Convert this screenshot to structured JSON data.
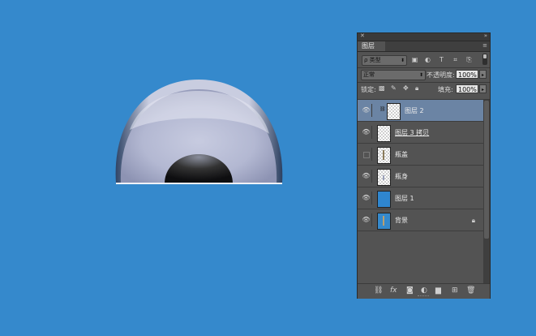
{
  "panel": {
    "tab_label": "图层",
    "close_symbol": "✕",
    "collapse_symbol": "»",
    "menu_symbol": "≡"
  },
  "filter": {
    "kind_label": "ρ 类型",
    "icons": [
      "image-filter-icon",
      "adjustment-filter-icon",
      "type-filter-icon",
      "shape-filter-icon",
      "smart-object-filter-icon"
    ]
  },
  "blend": {
    "mode": "正常",
    "opacity_label": "不透明度:",
    "opacity_value": "100%"
  },
  "lock": {
    "label": "锁定:",
    "fill_label": "填充:",
    "fill_value": "100%"
  },
  "layers": [
    {
      "name": "图层 2",
      "visible": true,
      "selected": true,
      "thumb": "transparent",
      "linked": true
    },
    {
      "name": "图层 3 拷贝",
      "visible": true,
      "selected": false,
      "thumb": "transparent",
      "underline": true
    },
    {
      "name": "瓶盖",
      "visible": false,
      "selected": false,
      "thumb": "transparent"
    },
    {
      "name": "瓶身",
      "visible": true,
      "selected": false,
      "thumb": "transparent"
    },
    {
      "name": "图层 1",
      "visible": true,
      "selected": false,
      "thumb": "blue"
    },
    {
      "name": "背景",
      "visible": true,
      "selected": false,
      "thumb": "background",
      "locked": true
    }
  ],
  "colors": {
    "canvas_background": "#3589cc",
    "panel_background": "#535353",
    "selected_layer": "#6b84a4"
  }
}
